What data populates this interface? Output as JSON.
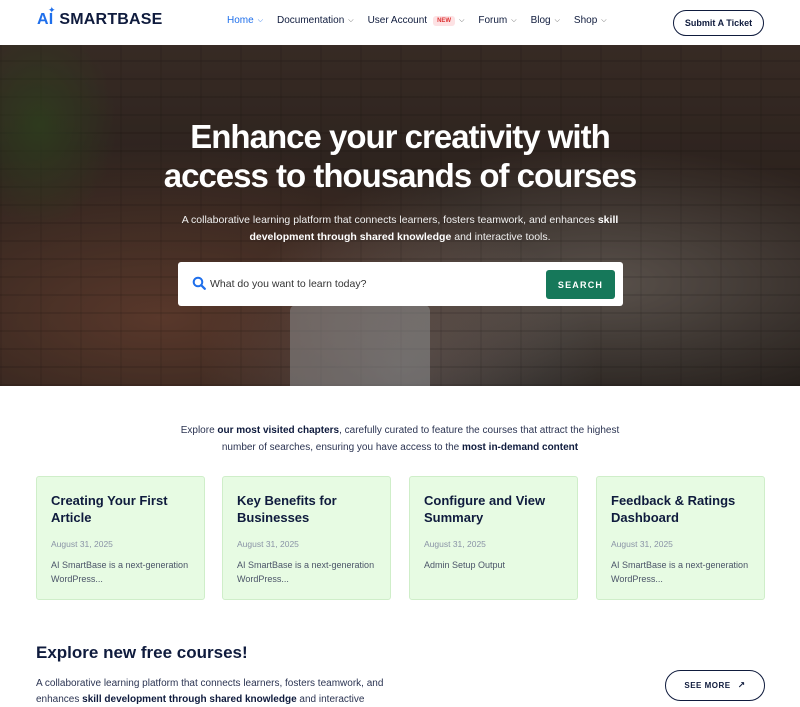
{
  "header": {
    "logo_ai": "AI",
    "logo_name": "SMARTBASE",
    "nav": [
      {
        "label": "Home",
        "active": true
      },
      {
        "label": "Documentation"
      },
      {
        "label": "User Account",
        "badge": "NEW"
      },
      {
        "label": "Forum"
      },
      {
        "label": "Blog"
      },
      {
        "label": "Shop"
      }
    ],
    "ticket_label": "Submit A Ticket"
  },
  "hero": {
    "title_line1": "Enhance your creativity with",
    "title_line2": "access to thousands of courses",
    "subtitle_a": "A collaborative learning platform that connects learners, fosters teamwork, and enhances ",
    "subtitle_b": "skill development through shared knowledge",
    "subtitle_c": " and interactive tools.",
    "search_placeholder": "What do you want to learn today?",
    "search_button": "SEARCH"
  },
  "intro": {
    "a": "Explore ",
    "b": "our most visited chapters",
    "c": ", carefully curated to feature the courses that attract the highest number of searches, ensuring you have access to the ",
    "d": "most in-demand content"
  },
  "cards": [
    {
      "title": "Creating Your First Article",
      "date": "August 31, 2025",
      "desc": "AI SmartBase is a next-generation WordPress..."
    },
    {
      "title": "Key Benefits for Businesses",
      "date": "August 31, 2025",
      "desc": "AI SmartBase is a next-generation WordPress..."
    },
    {
      "title": "Configure and View Summary",
      "date": "August 31, 2025",
      "desc": "Admin Setup Output"
    },
    {
      "title": "Feedback & Ratings Dashboard",
      "date": "August 31, 2025",
      "desc": "AI SmartBase is a next-generation WordPress..."
    }
  ],
  "explore": {
    "title": "Explore new free courses!",
    "desc_a": "A collaborative learning platform that connects learners, fosters teamwork, and enhances ",
    "desc_b": "skill development through shared knowledge",
    "desc_c": " and interactive",
    "see_more": "SEE MORE"
  },
  "colors": {
    "brand_blue": "#1f6feb",
    "accent_green": "#16785a",
    "card_bg": "#e7fbe3",
    "text_dark": "#0f1b3d"
  }
}
